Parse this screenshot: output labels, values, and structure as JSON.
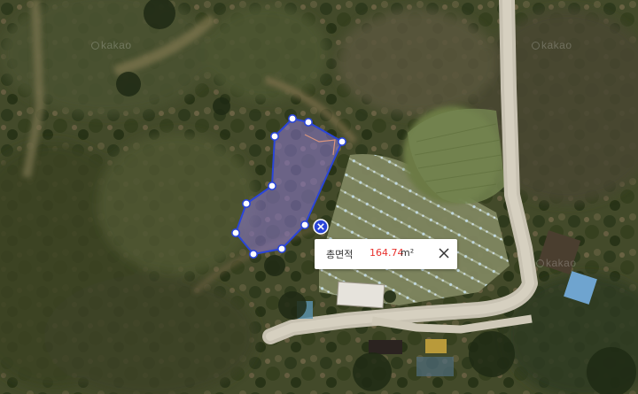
{
  "map": {
    "watermark": "kakao",
    "polygon_color": "#2a45d8",
    "vertex_count": 11
  },
  "area_popup": {
    "label": "총면적",
    "value": "164.74",
    "unit": "m²",
    "value_color": "#e8312d",
    "close_icon": "close-icon"
  },
  "delete_marker": {
    "icon": "close-icon",
    "color": "#2a45d8"
  }
}
